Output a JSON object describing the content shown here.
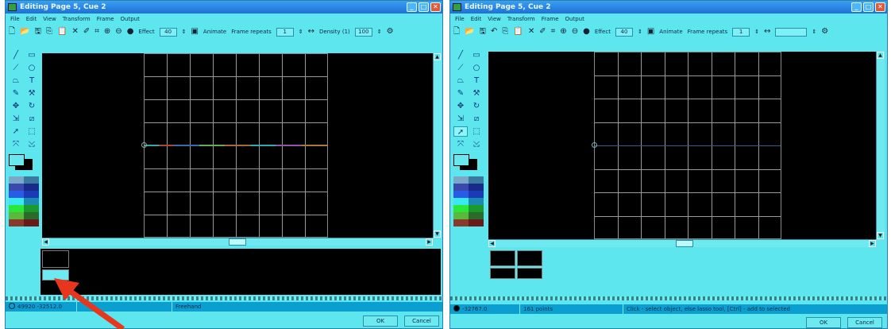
{
  "left": {
    "title": "Editing Page 5, Cue 2",
    "menu": [
      "File",
      "Edit",
      "View",
      "Transform",
      "Frame",
      "Output"
    ],
    "toolbar": {
      "effect_label": "Effect",
      "effect_value": "40",
      "animate_label": "Animate",
      "frame_repeats_label": "Frame repeats",
      "frame_repeats_value": "1",
      "density_label": "Density (1)",
      "density_value": "100"
    },
    "status": {
      "coords": "49920 -32512.0",
      "mode": "Freehand"
    },
    "ok_label": "OK",
    "cancel_label": "Cancel"
  },
  "right": {
    "title": "Editing Page 5, Cue 2",
    "menu": [
      "File",
      "Edit",
      "View",
      "Transform",
      "Frame",
      "Output"
    ],
    "toolbar": {
      "effect_label": "Effect",
      "effect_value": "40",
      "animate_label": "Animate",
      "frame_repeats_label": "Frame repeats",
      "frame_repeats_value": "1"
    },
    "status": {
      "coords": "-32767.0",
      "points": "161 points",
      "hint": "Click - select object, else lasso tool, [Ctrl] - add to selected"
    },
    "ok_label": "OK",
    "cancel_label": "Cancel"
  },
  "colors": {
    "window": "#5ee6ef",
    "canvas": "#000000",
    "grid": "#9a9a9a",
    "arrow": "#e8361e"
  },
  "palette": [
    "#7aa8c8",
    "#3a7aa0",
    "#3a4aa8",
    "#1a2a8a",
    "#2a5ae8",
    "#1a3ab8",
    "#3ae8f0",
    "#1a8ab0",
    "#2ae83a",
    "#1a9a2a",
    "#5ab83a",
    "#2a6a2a",
    "#8a3a2a",
    "#6a1a1a"
  ]
}
